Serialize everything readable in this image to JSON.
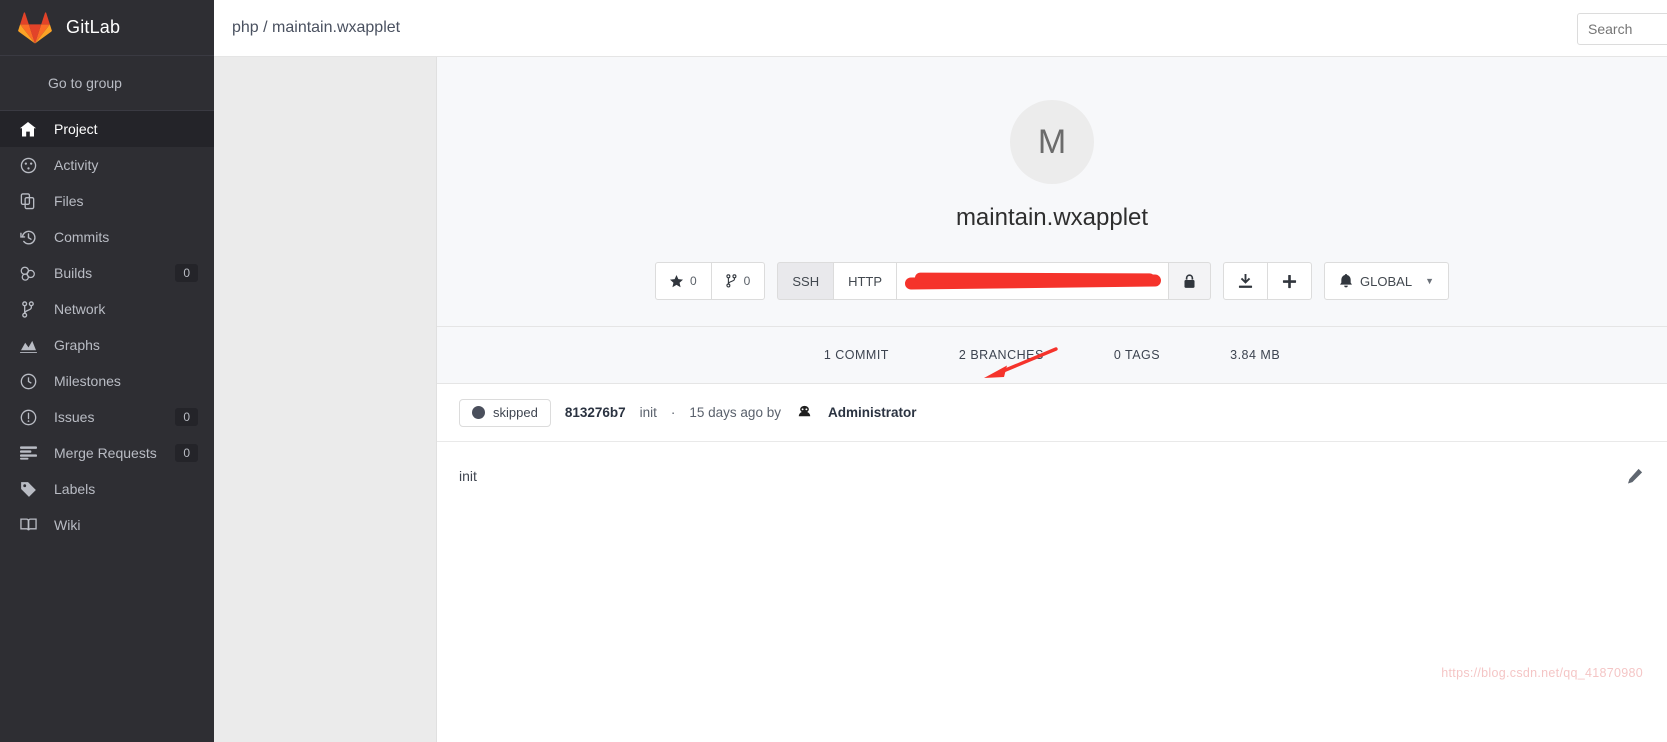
{
  "brand": {
    "name": "GitLab",
    "logo_icon": "gitlab-fox-logo"
  },
  "sidebar": {
    "go_to_group": "Go to group",
    "items": [
      {
        "label": "Project",
        "icon": "home-icon",
        "badge": null,
        "active": true
      },
      {
        "label": "Activity",
        "icon": "dashboard-icon",
        "badge": null,
        "active": false
      },
      {
        "label": "Files",
        "icon": "files-icon",
        "badge": null,
        "active": false
      },
      {
        "label": "Commits",
        "icon": "history-icon",
        "badge": null,
        "active": false
      },
      {
        "label": "Builds",
        "icon": "builds-icon",
        "badge": "0",
        "active": false
      },
      {
        "label": "Network",
        "icon": "branch-icon",
        "badge": null,
        "active": false
      },
      {
        "label": "Graphs",
        "icon": "chart-icon",
        "badge": null,
        "active": false
      },
      {
        "label": "Milestones",
        "icon": "clock-icon",
        "badge": null,
        "active": false
      },
      {
        "label": "Issues",
        "icon": "exclamation-icon",
        "badge": "0",
        "active": false
      },
      {
        "label": "Merge Requests",
        "icon": "merge-request-icon",
        "badge": "0",
        "active": false
      },
      {
        "label": "Labels",
        "icon": "tag-icon",
        "badge": null,
        "active": false
      },
      {
        "label": "Wiki",
        "icon": "book-icon",
        "badge": null,
        "active": false
      }
    ]
  },
  "topbar": {
    "breadcrumb": "php / maintain.wxapplet",
    "breadcrumb_group": "php",
    "breadcrumb_project": "maintain.wxapplet",
    "search_placeholder": "Search"
  },
  "project": {
    "avatar_letter": "M",
    "title": "maintain.wxapplet",
    "star_label": "star-icon",
    "star_count": "0",
    "fork_label": "fork-icon",
    "fork_count": "0",
    "protocol_ssh": "SSH",
    "protocol_http": "HTTP",
    "protocol_selected": "SSH",
    "clone_url": "",
    "lock_icon": "lock-icon",
    "download_icon": "download-icon",
    "plus_icon": "plus-icon",
    "notification_icon": "bell-icon",
    "notification_label": "GLOBAL",
    "notification_caret": "chevron-down-icon"
  },
  "stats": [
    {
      "label": "1 COMMIT",
      "name": "commits-stat"
    },
    {
      "label": "2 BRANCHES",
      "name": "branches-stat"
    },
    {
      "label": "0 TAGS",
      "name": "tags-stat"
    },
    {
      "label": "3.84 MB",
      "name": "repo-size-stat"
    }
  ],
  "last_commit": {
    "status": "skipped",
    "sha": "813276b7",
    "message": "init",
    "separator": "·",
    "time": "15 days ago by",
    "author": "Administrator"
  },
  "readme": {
    "text": "init",
    "edit_icon": "pencil-icon"
  },
  "watermark": "https://blog.csdn.net/qq_41870980",
  "colors": {
    "sidebar_bg": "#2e2e33",
    "sidebar_active": "#242429",
    "panel_bg": "#f7f8fa",
    "redaction": "#f5332b",
    "annotation_arrow": "#f5332b"
  }
}
